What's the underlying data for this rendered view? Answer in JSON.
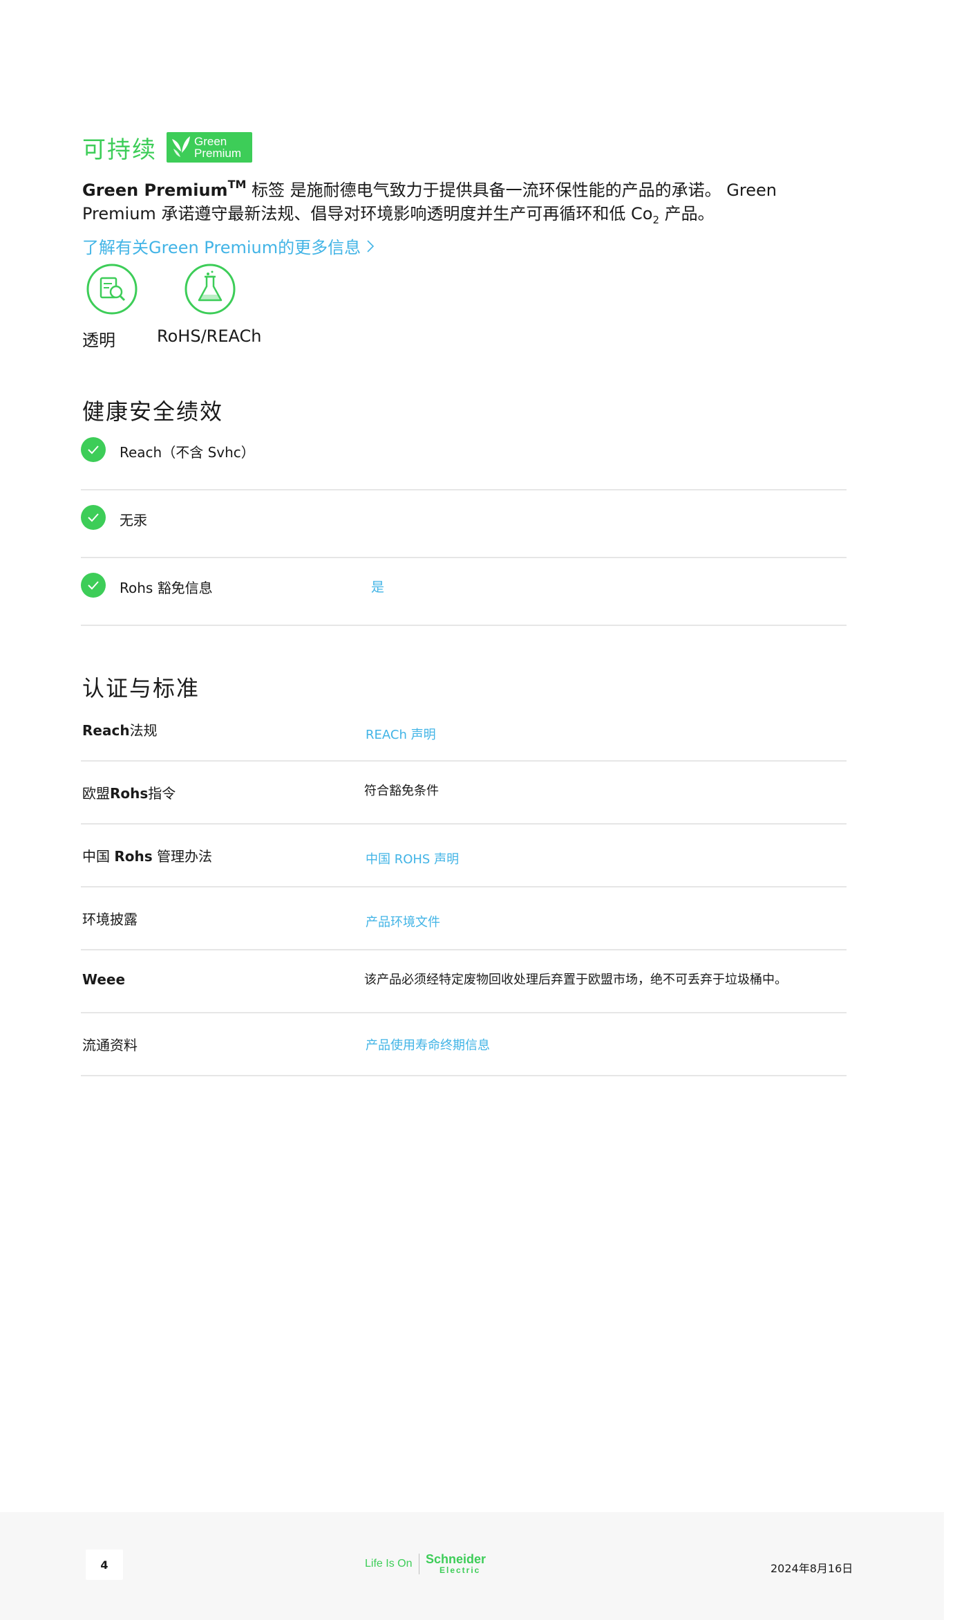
{
  "sustainability": {
    "title": "可持续",
    "badge": {
      "line1": "Green",
      "line2": "Premium",
      "color": "#3dcd58"
    },
    "description": {
      "brand": "Green Premium",
      "tm": "TM",
      "part1": " 标签 是施耐德电气致力于提供具备一流环保性能的产品的承诺。 Green Premium 承诺遵守最新法规、倡导对环境影响透明度并生产可再循环和低 Co",
      "co2_sub": "2",
      "part2": " 产品。"
    },
    "more_link": "了解有关Green Premium的更多信息",
    "icons": [
      {
        "icon": "transparency-search-icon",
        "label": "透明"
      },
      {
        "icon": "flask-icon",
        "label": "RoHS/REACh"
      }
    ]
  },
  "health": {
    "title": "健康安全绩效",
    "rows": [
      {
        "label": "Reach（不含 Svhc）",
        "value": ""
      },
      {
        "label": "无汞",
        "value": ""
      },
      {
        "label": "Rohs 豁免信息",
        "value": "是"
      }
    ]
  },
  "certs": {
    "title": "认证与标准",
    "rows": [
      {
        "label_bold": "Reach",
        "label": "法规",
        "value": "REACh 声明",
        "link": true
      },
      {
        "label_pre": "欧盟",
        "label_bold": "Rohs",
        "label": "指令",
        "value": "符合豁免条件",
        "link": false
      },
      {
        "label_pre": "中国 ",
        "label_bold": "Rohs",
        "label": " 管理办法",
        "value": "中国 ROHS 声明",
        "link": true
      },
      {
        "label": "环境披露",
        "value": "产品环境文件",
        "link": true
      },
      {
        "label_bold": "Weee",
        "label": "",
        "value": "该产品必须经特定废物回收处理后弃置于欧盟市场，绝不可丢弃于垃圾桶中。",
        "link": false
      },
      {
        "label": "流通资料",
        "value": "产品使用寿命终期信息",
        "link": true
      }
    ]
  },
  "footer": {
    "page": "4",
    "tagline": "Life Is On",
    "brand": "Schneider",
    "brand_sub": "Electric",
    "date": "2024年8月16日"
  },
  "colors": {
    "green": "#3dcd58",
    "link": "#42b4e6",
    "divider": "#e6e6e6"
  }
}
